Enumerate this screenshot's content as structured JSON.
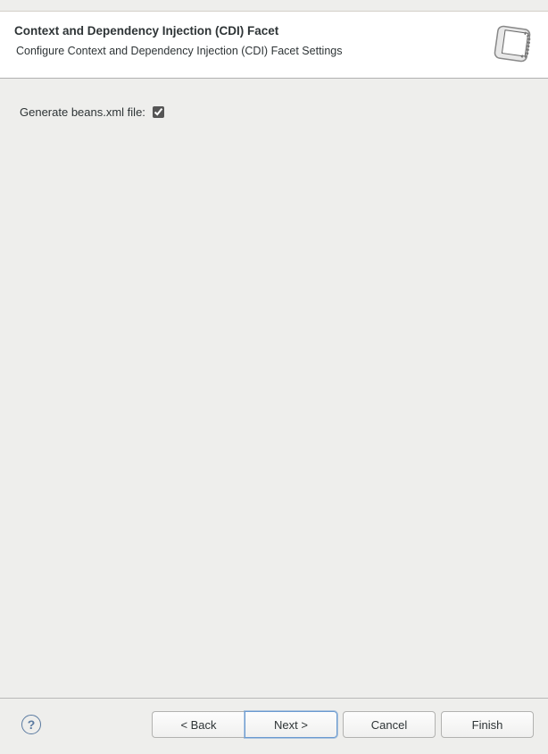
{
  "header": {
    "title": "Context and Dependency Injection (CDI) Facet",
    "subtitle": "Configure Context and Dependency Injection (CDI) Facet Settings"
  },
  "content": {
    "generate_beans_label": "Generate beans.xml file:",
    "generate_beans_checked": true
  },
  "footer": {
    "back_label": "< Back",
    "next_label": "Next >",
    "cancel_label": "Cancel",
    "finish_label": "Finish"
  }
}
